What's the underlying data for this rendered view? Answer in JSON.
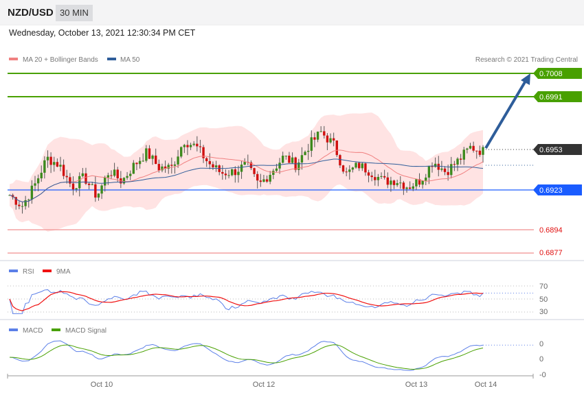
{
  "header": {
    "symbol": "NZD/USD",
    "timeframe": "30 MIN"
  },
  "date": "Wednesday, October 13, 2021 12:30:34 PM CET",
  "legend": {
    "ma20": "MA 20 + Bollinger Bands",
    "ma50": "MA 50",
    "copyright": "Research © 2021 Trading Central"
  },
  "colors": {
    "up": "#3d8a1e",
    "down": "#d01010",
    "band": "#ffe3e3",
    "ma20": "#f08080",
    "ma50": "#2e5d9a",
    "target": "#48a000",
    "support": "#1a5cff",
    "resist_red": "#e01010",
    "last": "#333333",
    "arrow": "#2e5d9a"
  },
  "levels": {
    "r2": "0.7008",
    "r1": "0.6991",
    "last": "0.6953",
    "pivot": "0.6923",
    "s1": "0.6894",
    "s2": "0.6877"
  },
  "rsi": {
    "label": "RSI",
    "ma_label": "9MA",
    "ticks": [
      "70",
      "50",
      "30"
    ]
  },
  "macd": {
    "label": "MACD",
    "signal_label": "MACD Signal",
    "ticks": [
      "0",
      "0",
      "-0"
    ]
  },
  "xaxis": {
    "labels": [
      "Oct 10",
      "Oct 12",
      "Oct 13",
      "Oct 14"
    ]
  },
  "chart_data": {
    "type": "candlestick",
    "close_anchors": [
      0.6919,
      0.6911,
      0.6926,
      0.6946,
      0.6941,
      0.6925,
      0.6932,
      0.6918,
      0.6937,
      0.6929,
      0.6941,
      0.695,
      0.6939,
      0.6939,
      0.6959,
      0.6954,
      0.6942,
      0.6935,
      0.6936,
      0.6941,
      0.6926,
      0.6936,
      0.6947,
      0.6941,
      0.6955,
      0.6965,
      0.6956,
      0.6934,
      0.6941,
      0.6936,
      0.6929,
      0.693,
      0.6925,
      0.693,
      0.6944,
      0.6936,
      0.6944,
      0.6954,
      0.6951
    ],
    "candles": 150,
    "price_range": [
      0.6877,
      0.7008
    ],
    "target_arrow_to": 0.7008
  }
}
